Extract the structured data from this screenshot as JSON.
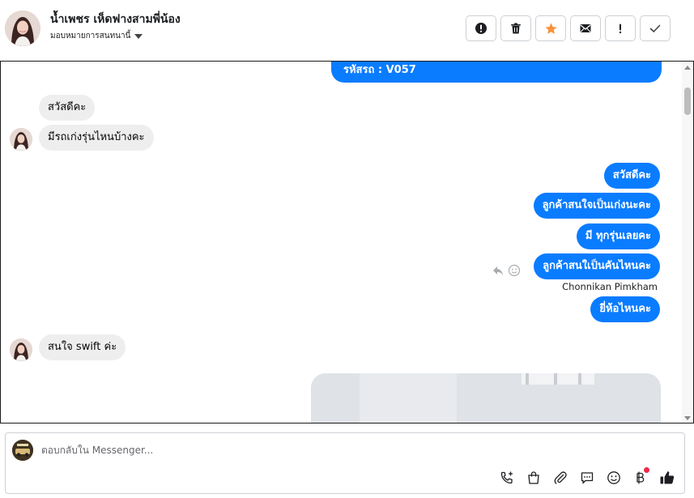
{
  "header": {
    "contact_name": "น้ำเพชร เห็ดฟางสามพี่น้อง",
    "assign_label": "มอบหมายการสนทนานี้",
    "toolbar": [
      {
        "name": "mark-spam-button",
        "icon": "alert-circle-icon"
      },
      {
        "name": "delete-button",
        "icon": "trash-icon"
      },
      {
        "name": "star-button",
        "icon": "star-icon",
        "color": "#f7923a"
      },
      {
        "name": "mark-unread-button",
        "icon": "envelope-icon"
      },
      {
        "name": "follow-up-button",
        "icon": "exclamation-icon"
      },
      {
        "name": "mark-done-button",
        "icon": "check-icon"
      }
    ]
  },
  "messages": {
    "top_bubble": "รหัสรถ : V057",
    "in_1": "สวัสดีคะ",
    "in_2": "มีรถเก่งรุ่นไหนบ้างคะ",
    "out_1": "สวัสดีคะ",
    "out_2": "ลูกค้าสนใจเป็นเก่งนะคะ",
    "out_3": "มี ทุกรุ่นเลยคะ",
    "out_4": "ลูกค้าสนใเป็นคันไหนคะ",
    "sender": "Chonnikan Pimkham",
    "out_5": "ยี่ห้อไหนคะ",
    "in_3": "สนใจ swift ค่ะ"
  },
  "composer": {
    "placeholder": "ตอบกลับใน Messenger..."
  },
  "colors": {
    "outgoing_bubble": "#0a7cff",
    "incoming_bubble": "#eeeeee",
    "notification_dot": "#f02849"
  }
}
